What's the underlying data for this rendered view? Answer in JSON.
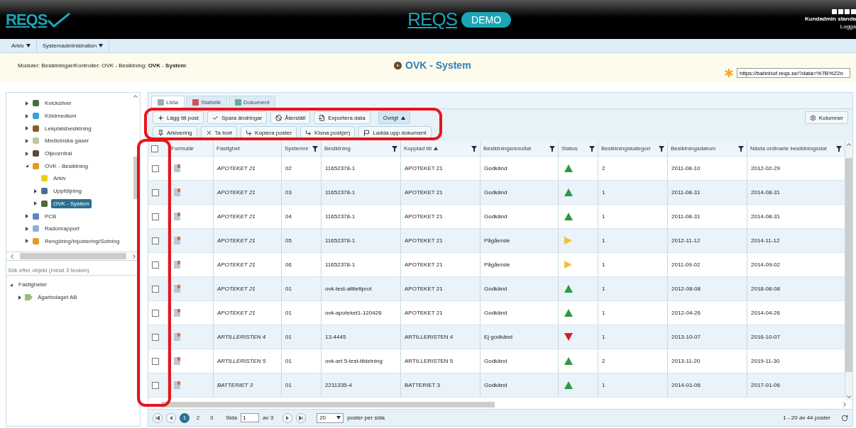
{
  "header": {
    "logo": "REQS",
    "center_logo": "REQS",
    "badge": "DEMO",
    "user": "Kundadmin standa",
    "logout": "Logga"
  },
  "menu": [
    {
      "label": "Arkiv"
    },
    {
      "label": "Systemadministration"
    }
  ],
  "breadcrumb": "Moduler: Besiktningar/Kontroller: OVK - Besiktning: **OVK** - **System**:",
  "page_title": "OVK - System",
  "url_field": {
    "value": "https://bahnhof.reqs.se/?data=%7B%22n"
  },
  "module_tree": [
    {
      "label": "Kvicksilver",
      "expandable": true,
      "expanded": false,
      "selected": false
    },
    {
      "label": "Köldmedium",
      "expandable": true,
      "expanded": false,
      "selected": false
    },
    {
      "label": "Lekplatsbesiktning",
      "expandable": true,
      "expanded": false,
      "selected": false
    },
    {
      "label": "Medicinska gaser",
      "expandable": true,
      "expanded": false,
      "selected": false
    },
    {
      "label": "Oljecentral",
      "expandable": true,
      "expanded": false,
      "selected": false
    },
    {
      "label": "OVK - Besiktning",
      "expandable": true,
      "expanded": true,
      "selected": false,
      "children": [
        {
          "label": "Arkiv",
          "expandable": false,
          "expanded": false,
          "selected": false
        },
        {
          "label": "Uppföljning",
          "expandable": true,
          "expanded": false,
          "selected": false
        },
        {
          "label": "OVK - System",
          "expandable": true,
          "expanded": false,
          "selected": true
        }
      ]
    },
    {
      "label": "PCB",
      "expandable": true,
      "expanded": false,
      "selected": false
    },
    {
      "label": "Radonrapport",
      "expandable": true,
      "expanded": false,
      "selected": false
    },
    {
      "label": "Rengöring/Injustering/Sotning",
      "expandable": true,
      "expanded": false,
      "selected": false
    }
  ],
  "object_search": {
    "placeholder": "Sök efter objekt (minst 3 tecken)"
  },
  "object_tree": [
    {
      "label": "Fastigheter",
      "expandable": true,
      "expanded": true,
      "children": [
        {
          "label": "Ägarbolaget AB",
          "expandable": true,
          "expanded": false
        }
      ]
    }
  ],
  "tabs": [
    {
      "label": "Lista",
      "selected": true
    },
    {
      "label": "Statistik",
      "selected": false
    },
    {
      "label": "Dokument",
      "selected": false
    }
  ],
  "toolbar_rows": [
    [
      {
        "label": "Lägg till post",
        "kind": "add",
        "pressed": false
      },
      {
        "label": "Spara ändringar",
        "kind": "save",
        "pressed": false
      },
      {
        "label": "Återställ",
        "kind": "reset",
        "pressed": false
      },
      {
        "label": "Exportera data",
        "kind": "export",
        "pressed": false
      },
      {
        "label": "Övrigt",
        "kind": "menu",
        "pressed": true
      }
    ],
    [
      {
        "label": "Arkivering",
        "kind": "archive",
        "pressed": false
      },
      {
        "label": "Ta bort",
        "kind": "delete",
        "pressed": false
      },
      {
        "label": "Kopiera poster",
        "kind": "copy",
        "pressed": false
      },
      {
        "label": "Klona post(er)",
        "kind": "clone",
        "pressed": false
      },
      {
        "label": "Ladda upp dokument",
        "kind": "upload",
        "pressed": false
      }
    ]
  ],
  "columns_button": "Kolumner",
  "table": {
    "all_checked": false,
    "columns": [
      {
        "label": "Formulär",
        "filter": false,
        "sorted": false
      },
      {
        "label": "Fastighet",
        "filter": false,
        "sorted": false
      },
      {
        "label": "Systemnr",
        "filter": true,
        "sorted": false
      },
      {
        "label": "Besiktning",
        "filter": true,
        "sorted": false
      },
      {
        "label": "Kopplad till",
        "filter": true,
        "sorted": true
      },
      {
        "label": "Besiktningsresultat",
        "filter": true,
        "sorted": false
      },
      {
        "label": "Status",
        "filter": true,
        "sorted": false
      },
      {
        "label": "Besiktningskategori",
        "filter": true,
        "sorted": false
      },
      {
        "label": "Besiktningsdatum",
        "filter": true,
        "sorted": false
      },
      {
        "label": "Nästa ordinarie besiktningsdat",
        "filter": true,
        "sorted": false
      }
    ],
    "rows": [
      {
        "checked": false,
        "fastighet": "APOTEKET 21",
        "systemnr": "02",
        "besiktning": "11652378-1",
        "kopplad": "APOTEKET 21",
        "resultat": "Godkänd",
        "kind": "up",
        "kategori": "2",
        "datum": "2011-08-10",
        "nasta": "2012-02-29"
      },
      {
        "checked": false,
        "fastighet": "APOTEKET 21",
        "systemnr": "03",
        "besiktning": "11652378-1",
        "kopplad": "APOTEKET 21",
        "resultat": "Godkänd",
        "kind": "up",
        "kategori": "1",
        "datum": "2011-08-31",
        "nasta": "2014-08-31"
      },
      {
        "checked": false,
        "fastighet": "APOTEKET 21",
        "systemnr": "04",
        "besiktning": "11652378-1",
        "kopplad": "APOTEKET 21",
        "resultat": "Godkänd",
        "kind": "up",
        "kategori": "1",
        "datum": "2011-08-31",
        "nasta": "2014-08-31"
      },
      {
        "checked": false,
        "fastighet": "APOTEKET 21",
        "systemnr": "05",
        "besiktning": "11652378-1",
        "kopplad": "APOTEKET 21",
        "resultat": "Pågående",
        "kind": "right",
        "kategori": "1",
        "datum": "2012-11-12",
        "nasta": "2014-11-12"
      },
      {
        "checked": false,
        "fastighet": "APOTEKET 21",
        "systemnr": "06",
        "besiktning": "11652378-1",
        "kopplad": "APOTEKET 21",
        "resultat": "Pågående",
        "kind": "right",
        "kategori": "1",
        "datum": "2011-09-02",
        "nasta": "2014-09-02"
      },
      {
        "checked": false,
        "fastighet": "APOTEKET 21",
        "systemnr": "01",
        "besiktning": "ovk-test-alltiettprot",
        "kopplad": "APOTEKET 21",
        "resultat": "Godkänd",
        "kind": "up",
        "kategori": "1",
        "datum": "2012-08-08",
        "nasta": "2018-08-08"
      },
      {
        "checked": false,
        "fastighet": "APOTEKET 21",
        "systemnr": "01",
        "besiktning": "ovk-apoteket1-120426",
        "kopplad": "APOTEKET 21",
        "resultat": "Godkänd",
        "kind": "up",
        "kategori": "1",
        "datum": "2012-04-26",
        "nasta": "2014-04-26"
      },
      {
        "checked": false,
        "fastighet": "ARTILLERISTEN 4",
        "systemnr": "01",
        "besiktning": "13-4445",
        "kopplad": "ARTILLERISTEN 4",
        "resultat": "Ej godkänd",
        "kind": "down",
        "kategori": "1",
        "datum": "2013-10-07",
        "nasta": "2016-10-07"
      },
      {
        "checked": false,
        "fastighet": "ARTILLERISTEN 5",
        "systemnr": "01",
        "besiktning": "ovk-art 5-test-tildelning",
        "kopplad": "ARTILLERISTEN 5",
        "resultat": "Godkänd",
        "kind": "up",
        "kategori": "2",
        "datum": "2013-11-20",
        "nasta": "2019-11-30"
      },
      {
        "checked": false,
        "fastighet": "BATTERIET 3",
        "systemnr": "01",
        "besiktning": "2211335-4",
        "kopplad": "BATTERIET 3",
        "resultat": "Godkänd",
        "kind": "up",
        "kategori": "1",
        "datum": "2014-01-06",
        "nasta": "2017-01-06"
      }
    ]
  },
  "pager": {
    "pages": [
      {
        "label": "1",
        "selected": true
      },
      {
        "label": "2",
        "selected": false
      },
      {
        "label": "3",
        "selected": false
      }
    ],
    "page_label": "Sida",
    "page_value": "1",
    "page_total": "av 3",
    "page_size": "20",
    "page_size_label": "poster per sida",
    "summary": "1 - 20 av 44 poster"
  },
  "highlights": {
    "toolbar": true,
    "row_select": true
  }
}
